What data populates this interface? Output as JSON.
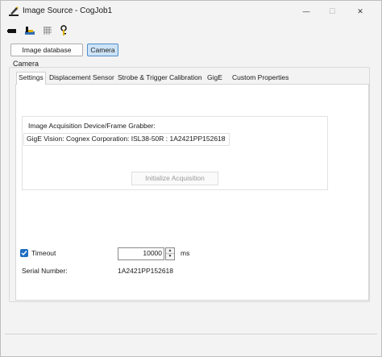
{
  "window": {
    "title": "Image Source - CogJob1",
    "minimize_symbol": "—",
    "maximize_symbol": "☐",
    "close_symbol": "✕"
  },
  "toolbar": {
    "icons": [
      "camera-icon",
      "image-stack-icon",
      "grid-icon",
      "key-icon"
    ]
  },
  "mode_buttons": {
    "image_database": "Image database",
    "camera": "Camera",
    "selected": "Camera"
  },
  "camera_group": {
    "label": "Camera"
  },
  "tabs": [
    {
      "label": "Settings",
      "active": true
    },
    {
      "label": "Displacement Sensor",
      "active": false
    },
    {
      "label": "Strobe & Trigger",
      "active": false
    },
    {
      "label": "Calibration",
      "active": false
    },
    {
      "label": "GigE",
      "active": false
    },
    {
      "label": "Custom Properties",
      "active": false
    }
  ],
  "settings": {
    "device_label": "Image Acquisition Device/Frame Grabber:",
    "device_value": "GigE Vision: Cognex Corporation: ISL38-50R : 1A2421PP152618",
    "initialize_button": "Initialize Acquisition",
    "timeout_checked": true,
    "timeout_label": "Timeout",
    "timeout_value": "10000",
    "timeout_unit": "ms",
    "serial_label": "Serial Number:",
    "serial_value": "1A2421PP152618"
  },
  "colors": {
    "accent": "#1f6fc2",
    "selected_button_bg": "#cde3f7"
  }
}
